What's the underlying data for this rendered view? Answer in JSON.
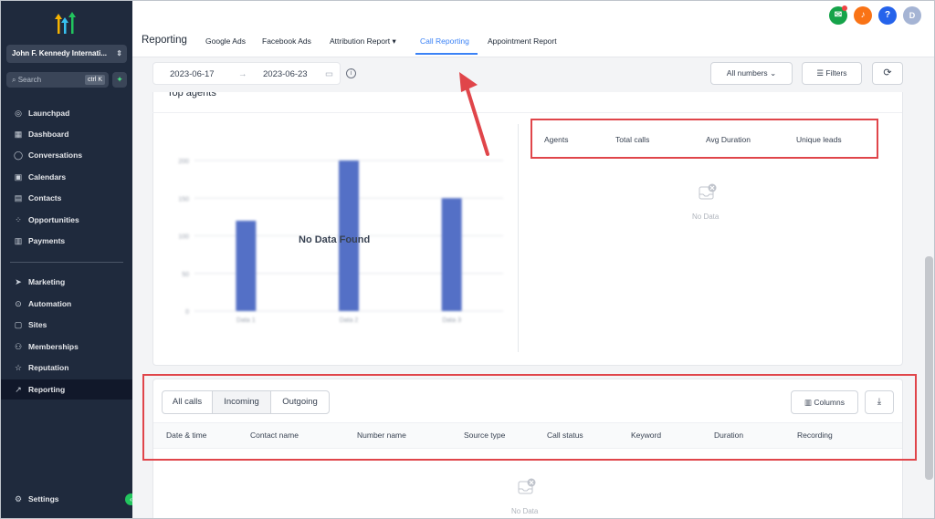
{
  "sidebar": {
    "location": "John F. Kennedy Internati...",
    "search_placeholder": "Search",
    "search_shortcut": "ctrl K",
    "items": [
      {
        "label": "Launchpad",
        "icon": "rocket-icon"
      },
      {
        "label": "Dashboard",
        "icon": "grid-icon"
      },
      {
        "label": "Conversations",
        "icon": "chat-icon"
      },
      {
        "label": "Calendars",
        "icon": "calendar-icon"
      },
      {
        "label": "Contacts",
        "icon": "contacts-icon"
      },
      {
        "label": "Opportunities",
        "icon": "opportunities-icon"
      },
      {
        "label": "Payments",
        "icon": "payments-icon"
      },
      {
        "label": "Marketing",
        "icon": "send-icon"
      },
      {
        "label": "Automation",
        "icon": "automation-icon"
      },
      {
        "label": "Sites",
        "icon": "sites-icon"
      },
      {
        "label": "Memberships",
        "icon": "badge-icon"
      },
      {
        "label": "Reputation",
        "icon": "star-icon"
      },
      {
        "label": "Reporting",
        "icon": "trend-icon"
      }
    ],
    "settings": "Settings"
  },
  "topbar": {
    "title": "Reporting",
    "tabs": [
      "Google Ads",
      "Facebook Ads",
      "Attribution Report",
      "Call Reporting",
      "Appointment Report"
    ],
    "active_tab": "Call Reporting",
    "avatar_initial": "D",
    "help_label": "?"
  },
  "filters": {
    "start_date": "2023-06-17",
    "end_date": "2023-06-23",
    "numbers_select": "All numbers",
    "filters_label": "Filters"
  },
  "top_agents": {
    "title": "Top agents",
    "chart_overlay": "No Data Found",
    "table_headers": [
      "Agents",
      "Total calls",
      "Avg Duration",
      "Unique leads"
    ],
    "empty_text": "No Data"
  },
  "calls": {
    "segments": [
      "All calls",
      "Incoming",
      "Outgoing"
    ],
    "active_segment": "Incoming",
    "columns_label": "Columns",
    "table_headers": [
      "Date & time",
      "Contact name",
      "Number name",
      "Source type",
      "Call status",
      "Keyword",
      "Duration",
      "Recording"
    ],
    "empty_text": "No Data"
  },
  "chart_data": {
    "type": "bar",
    "categories": [
      "Data 1",
      "Data 2",
      "Data 3"
    ],
    "values": [
      120,
      200,
      150
    ],
    "ylim": [
      0,
      200
    ],
    "yticks": [
      "0",
      "50",
      "100",
      "150",
      "200"
    ],
    "color": "#5470c6"
  },
  "colors": {
    "sidebar_bg": "#1f2a3d",
    "accent": "#3b82f6",
    "highlight_red": "#e0454a"
  }
}
